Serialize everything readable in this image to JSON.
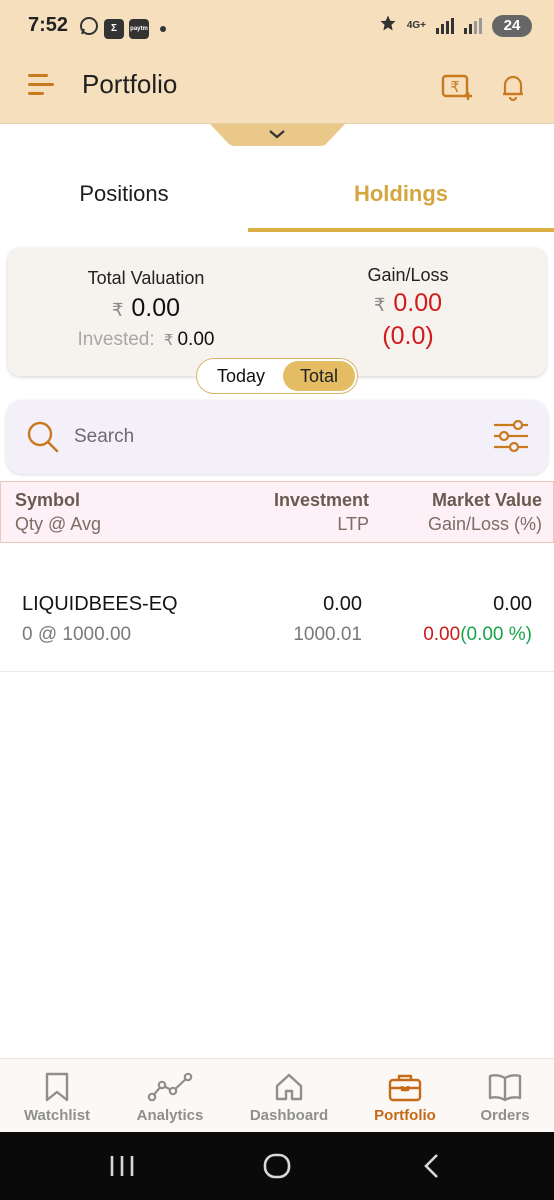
{
  "status_bar": {
    "time": "7:52",
    "notif_icons": [
      "whatsapp-icon",
      "sigma-icon",
      "paytm-icon"
    ],
    "paytm_label": "paytm",
    "network": "4G+",
    "battery": "24"
  },
  "header": {
    "title": "Portfolio",
    "icons": [
      "menu-icon",
      "add-funds-icon",
      "bell-icon"
    ]
  },
  "tabs": [
    {
      "label": "Positions",
      "active": false
    },
    {
      "label": "Holdings",
      "active": true
    }
  ],
  "summary": {
    "total_valuation_label": "Total Valuation",
    "currency": "₹",
    "total_valuation": "0.00",
    "invested_label": "Invested:",
    "invested": "0.00",
    "gain_loss_label": "Gain/Loss",
    "gain_loss": "0.00",
    "gain_loss_pct": "(0.0)",
    "toggle": {
      "options": [
        "Today",
        "Total"
      ],
      "selected": "Total"
    }
  },
  "search": {
    "placeholder": "Search"
  },
  "table": {
    "headers": {
      "symbol": "Symbol",
      "qty_avg": "Qty @ Avg",
      "investment": "Investment",
      "ltp": "LTP",
      "market_value": "Market Value",
      "gain_loss_pct": "Gain/Loss (%)"
    },
    "rows": [
      {
        "symbol": "LIQUIDBEES-EQ",
        "qty_avg": "0 @ 1000.00",
        "investment": "0.00",
        "ltp": "1000.01",
        "market_value": "0.00",
        "gain_loss": "0.00",
        "gain_loss_pct": "(0.00 %)"
      }
    ]
  },
  "bottom_nav": [
    {
      "label": "Watchlist",
      "icon": "bookmark-icon",
      "active": false
    },
    {
      "label": "Analytics",
      "icon": "analytics-icon",
      "active": false
    },
    {
      "label": "Dashboard",
      "icon": "home-icon",
      "active": false
    },
    {
      "label": "Portfolio",
      "icon": "briefcase-icon",
      "active": true
    },
    {
      "label": "Orders",
      "icon": "book-icon",
      "active": false
    }
  ],
  "colors": {
    "header_bg": "#f6dfbd",
    "accent_gold": "#d9ae45",
    "accent_orange": "#c56a16",
    "loss_red": "#d11a1a",
    "gain_green": "#19a34a"
  }
}
